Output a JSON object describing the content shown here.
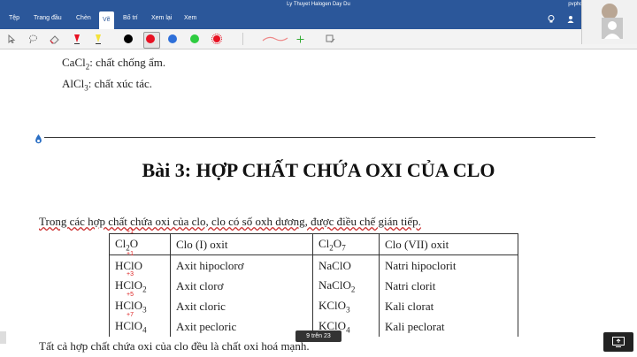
{
  "titlebar": {
    "title": "Ly Thuyet Halogen Day Du",
    "user": "pvpho.gdbt"
  },
  "ribbon": {
    "tabs": [
      "Tệp",
      "Trang đầu",
      "Chèn",
      "Vẽ",
      "Bố trí",
      "Xem lại",
      "Xem"
    ],
    "active_tab": "Vẽ"
  },
  "toolbar": {
    "tools": [
      "select-tool",
      "lasso-tool",
      "eraser-tool",
      "pen-tool",
      "highlighter-tool"
    ],
    "colors": [
      "#000000",
      "#e81123",
      "#2e6fd9",
      "#2ecc40",
      "#e81123"
    ]
  },
  "doc": {
    "line1": {
      "formula": "CaCl",
      "sub": "2",
      "text": ": chất chống ẩm."
    },
    "line2": {
      "formula": "AlCl",
      "sub": "3",
      "text": ": chất xúc tác."
    },
    "heading": "Bài 3: HỢP CHẤT CHỨA OXI CỦA CLO",
    "intro": "Trong các hợp chất chứa oxi của clo, clo có số oxh dương, được điều chế gián tiếp.",
    "table": {
      "rows": [
        {
          "f1": "Cl",
          "f1sub": "2",
          "f1tail": "O",
          "n1": "Clo (I) oxit",
          "f2": "Cl",
          "f2sub": "2",
          "f2tail": "O",
          "f2sub2": "7",
          "n2": "Clo (VII) oxit"
        },
        {
          "f1": "HClO",
          "f1sub": "",
          "f1tail": "",
          "n1": "Axit hipoclorơ",
          "f2": "NaClO",
          "f2sub": "",
          "f2tail": "",
          "f2sub2": "",
          "n2": "Natri hipoclorit"
        },
        {
          "f1": "HClO",
          "f1sub": "2",
          "f1tail": "",
          "n1": "Axit clorơ",
          "f2": "NaClO",
          "f2sub": "2",
          "f2tail": "",
          "f2sub2": "",
          "n2": "Natri clorit"
        },
        {
          "f1": "HClO",
          "f1sub": "3",
          "f1tail": "",
          "n1": "Axit cloric",
          "f2": "KClO",
          "f2sub": "3",
          "f2tail": "",
          "f2sub2": "",
          "n2": "Kali clorat"
        },
        {
          "f1": "HClO",
          "f1sub": "4",
          "f1tail": "",
          "n1": "Axit pecloric",
          "f2": "KClO",
          "f2sub": "4",
          "f2tail": "",
          "f2sub2": "",
          "n2": "Kali peclorat"
        }
      ],
      "annotations": [
        "+1",
        "+1",
        "+3",
        "+5",
        "+7"
      ]
    },
    "footer": "Tất cả hợp chất chứa oxi của clo đều là chất oxi hoá mạnh."
  },
  "page_indicator": "9 trên 23"
}
